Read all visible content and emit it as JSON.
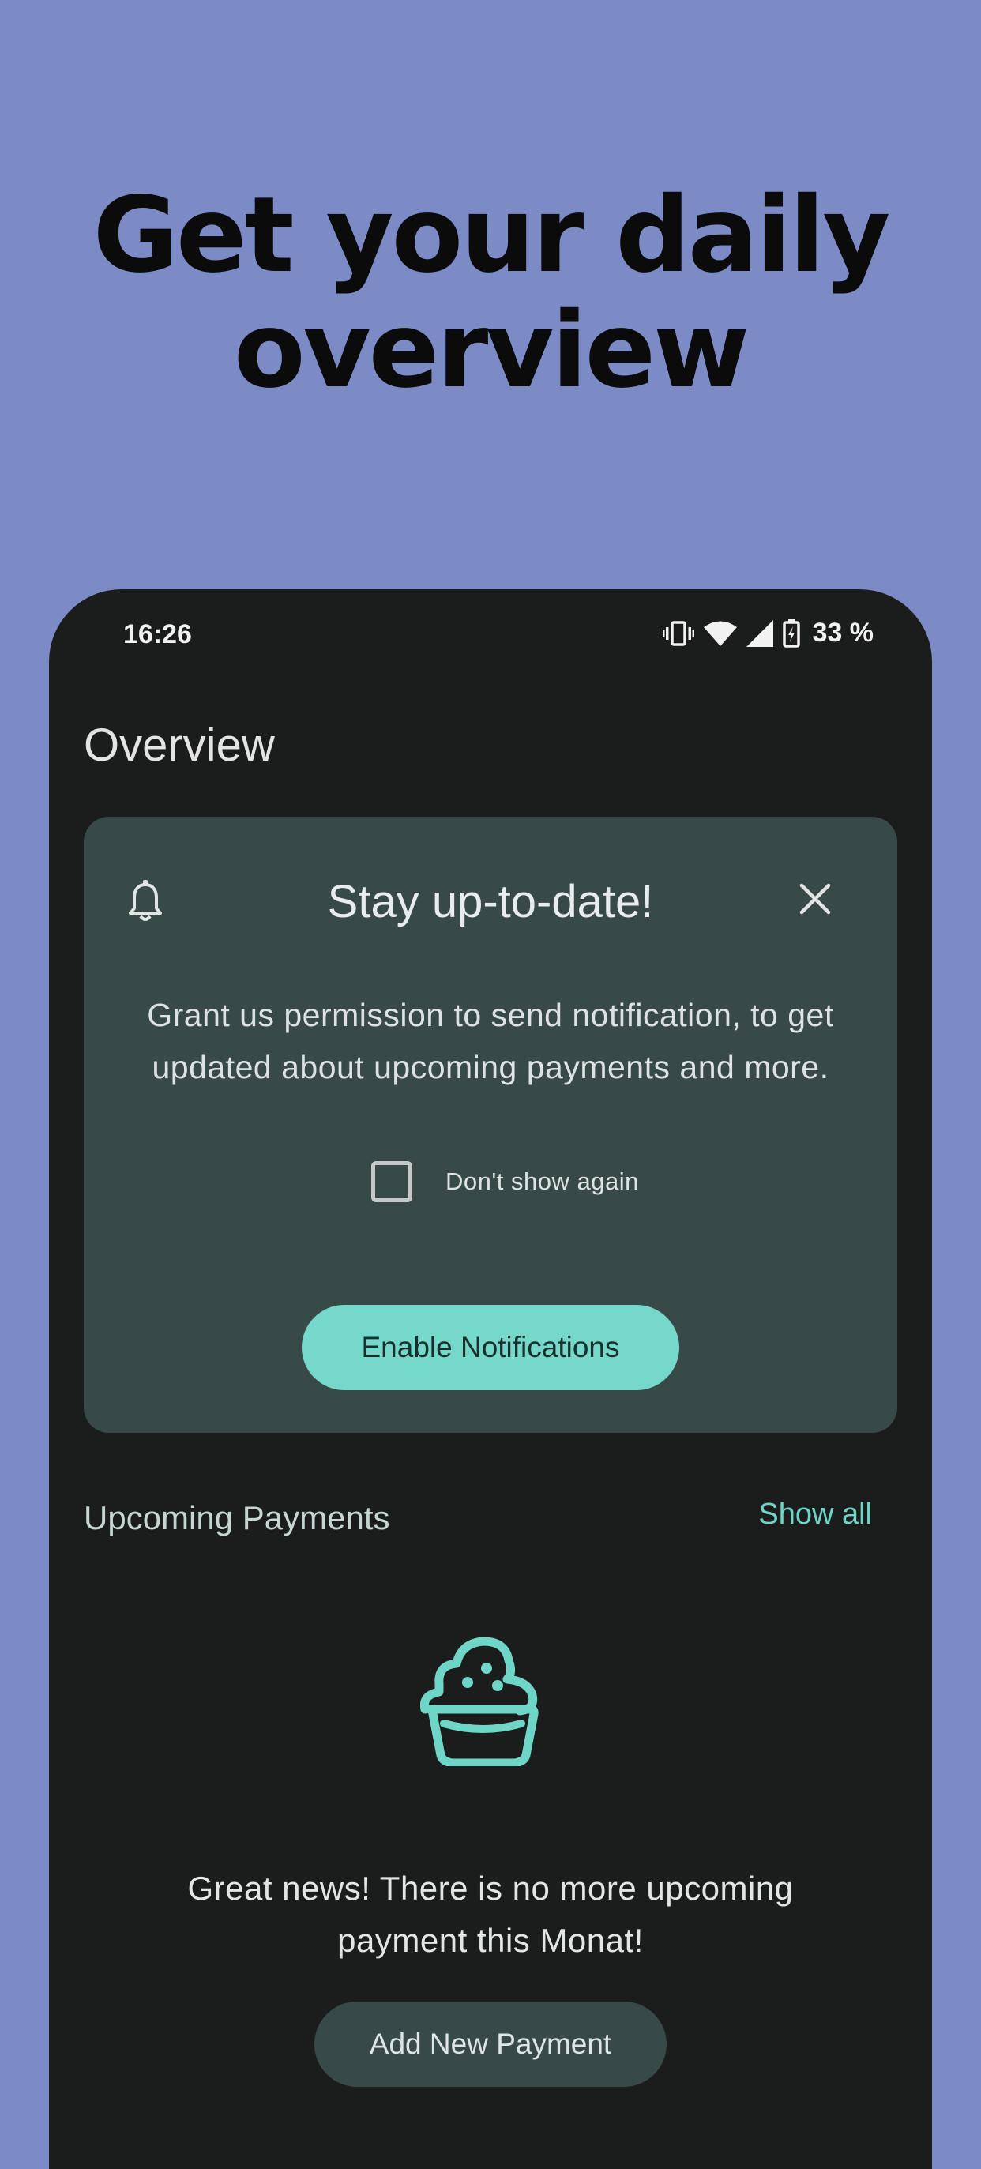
{
  "promo": {
    "headline_line1": "Get your daily",
    "headline_line2": "overview"
  },
  "status_bar": {
    "time": "16:26",
    "battery": "33 %"
  },
  "screen": {
    "title": "Overview"
  },
  "notification_card": {
    "title": "Stay up-to-date!",
    "body": "Grant us permission to send notification, to get updated about upcoming payments and more.",
    "checkbox_label": "Don't show again",
    "checkbox_checked": false,
    "button_label": "Enable Notifications"
  },
  "upcoming": {
    "title": "Upcoming Payments",
    "show_all": "Show all",
    "empty_message": "Great news! There is no more upcoming payment this Monat!",
    "add_button": "Add New Payment"
  },
  "colors": {
    "background": "#7c8bc6",
    "phone": "#1b1c1c",
    "card": "#384a48",
    "accent": "#76d8cb"
  },
  "icons": [
    "vibrate-icon",
    "wifi-icon",
    "signal-icon",
    "battery-charging-icon",
    "bell-icon",
    "close-icon",
    "cupcake-icon"
  ]
}
